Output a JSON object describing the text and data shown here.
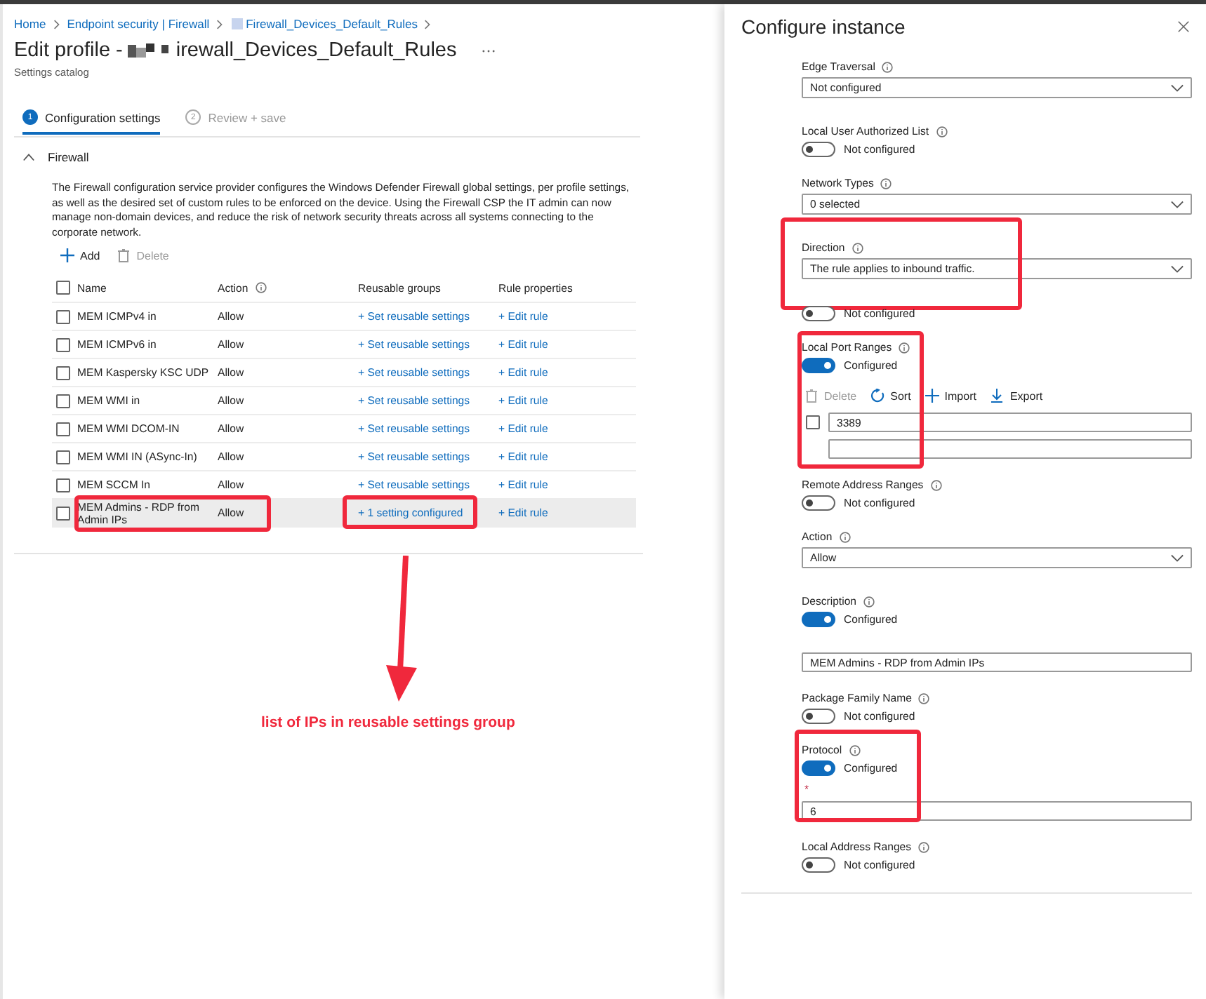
{
  "breadcrumb": [
    {
      "label": "Home",
      "has_icon": false
    },
    {
      "label": "Endpoint security | Firewall",
      "has_icon": false
    },
    {
      "label": "Firewall_Devices_Default_Rules",
      "has_icon": true
    }
  ],
  "title": {
    "prefix": "Edit profile -",
    "redacted": true,
    "suffix": "irewall_Devices_Default_Rules"
  },
  "subtitle": "Settings catalog",
  "steps": [
    {
      "number": "1",
      "label": "Configuration settings",
      "selected": true
    },
    {
      "number": "2",
      "label": "Review + save",
      "selected": false
    }
  ],
  "section": {
    "title": "Firewall",
    "expanded": true,
    "description": "The Firewall configuration service provider configures the Windows Defender Firewall global settings, per profile settings, as well as the desired set of custom rules to be enforced on the device. Using the Firewall CSP the IT admin can now manage non-domain devices, and reduce the risk of network security threats across all systems connecting to the corporate network.",
    "toolbar": [
      {
        "kind": "add",
        "label": "Add",
        "disabled": false
      },
      {
        "kind": "delete",
        "label": "Delete",
        "disabled": true
      }
    ],
    "table": {
      "all_checked": false,
      "columns": [
        {
          "label": "Name",
          "info": false
        },
        {
          "label": "Action",
          "info": true
        },
        {
          "label": "Reusable groups",
          "info": false
        },
        {
          "label": "Rule properties",
          "info": false
        }
      ],
      "rows": [
        {
          "name": "MEM ICMPv4 in",
          "action": "Allow",
          "groups": "+ Set reusable settings",
          "rule": "+ Edit rule",
          "checked": false,
          "selected": false,
          "highlighted": false
        },
        {
          "name": "MEM ICMPv6 in",
          "action": "Allow",
          "groups": "+ Set reusable settings",
          "rule": "+ Edit rule",
          "checked": false,
          "selected": false,
          "highlighted": false
        },
        {
          "name": "MEM Kaspersky KSC UDP",
          "action": "Allow",
          "groups": "+ Set reusable settings",
          "rule": "+ Edit rule",
          "checked": false,
          "selected": false,
          "highlighted": false
        },
        {
          "name": "MEM WMI in",
          "action": "Allow",
          "groups": "+ Set reusable settings",
          "rule": "+ Edit rule",
          "checked": false,
          "selected": false,
          "highlighted": false
        },
        {
          "name": "MEM WMI DCOM-IN",
          "action": "Allow",
          "groups": "+ Set reusable settings",
          "rule": "+ Edit rule",
          "checked": false,
          "selected": false,
          "highlighted": false
        },
        {
          "name": "MEM WMI IN (ASync-In)",
          "action": "Allow",
          "groups": "+ Set reusable settings",
          "rule": "+ Edit rule",
          "checked": false,
          "selected": false,
          "highlighted": false
        },
        {
          "name": "MEM SCCM In",
          "action": "Allow",
          "groups": "+ Set reusable settings",
          "rule": "+ Edit rule",
          "checked": false,
          "selected": false,
          "highlighted": false
        },
        {
          "name": "MEM Admins - RDP from Admin IPs",
          "action": "Allow",
          "groups": "+ 1 setting configured",
          "rule": "+ Edit rule",
          "checked": false,
          "selected": true,
          "highlighted": true
        }
      ]
    }
  },
  "annotation": {
    "caption": "list of IPs in reusable settings group"
  },
  "panel": {
    "title": "Configure instance",
    "settings": [
      {
        "kind": "select",
        "label": "Edge Traversal",
        "value": "Not configured",
        "highlighted": false
      },
      {
        "kind": "toggle",
        "label": "Local User Authorized List",
        "on": false,
        "status": "Not configured",
        "highlighted": false
      },
      {
        "kind": "select",
        "label": "Network Types",
        "value": "0 selected",
        "highlighted": false
      },
      {
        "kind": "select",
        "label": "Direction",
        "value": "The rule applies to inbound traffic.",
        "highlighted": true
      },
      {
        "kind": "toggle",
        "on": false,
        "status": "Not configured",
        "highlighted": false
      },
      {
        "kind": "list",
        "label": "Local Port Ranges",
        "on": true,
        "status": "Configured",
        "highlighted": true,
        "toolbar": [
          {
            "kind": "delete",
            "label": "Delete",
            "disabled": true
          },
          {
            "kind": "sort",
            "label": "Sort",
            "disabled": false
          },
          {
            "kind": "add",
            "label": "Import",
            "disabled": false
          },
          {
            "kind": "export",
            "label": "Export",
            "disabled": false
          }
        ],
        "entries": [
          {
            "value": "3389",
            "checked": false
          }
        ]
      },
      {
        "kind": "toggle",
        "label": "Remote Address Ranges",
        "on": false,
        "status": "Not configured",
        "highlighted": false
      },
      {
        "kind": "select",
        "label": "Action",
        "value": "Allow",
        "highlighted": false
      },
      {
        "kind": "text",
        "label": "Description",
        "on": true,
        "status": "Configured",
        "value": "MEM Admins - RDP from Admin IPs",
        "highlighted": false
      },
      {
        "kind": "toggle",
        "label": "Package Family Name",
        "on": false,
        "status": "Not configured",
        "highlighted": false
      },
      {
        "kind": "text",
        "label": "Protocol",
        "on": true,
        "status": "Configured",
        "required_mark": "*",
        "value": "6",
        "highlighted": true
      },
      {
        "kind": "toggle",
        "label": "Local Address Ranges",
        "on": false,
        "status": "Not configured",
        "highlighted": false
      }
    ]
  }
}
